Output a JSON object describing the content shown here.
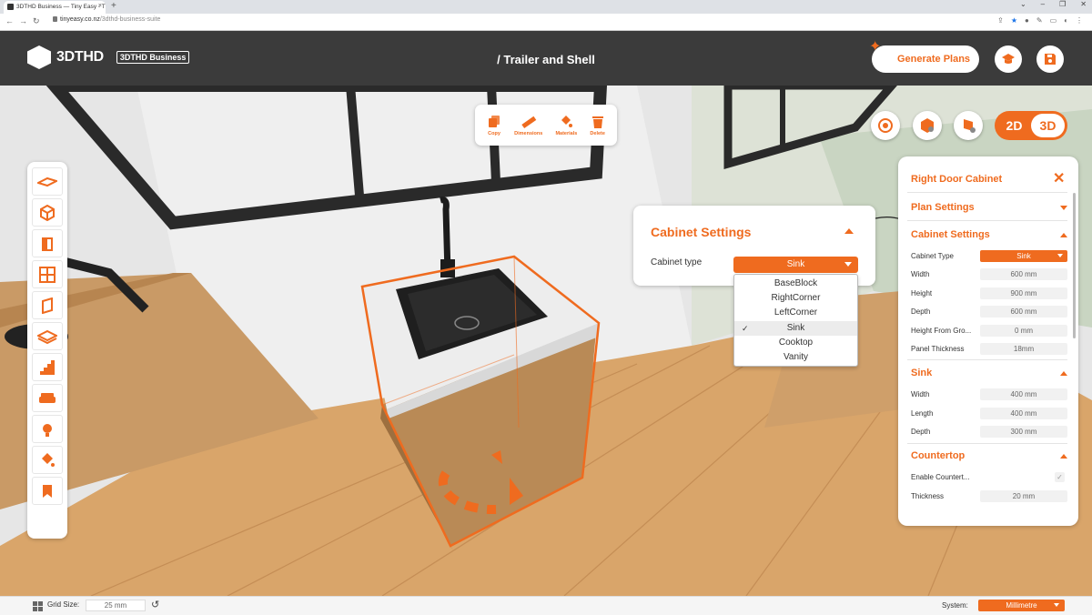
{
  "browser": {
    "tab_title": "3DTHD Business — Tiny Easy - T",
    "url_host": "tinyeasy.co.nz",
    "url_path": "/3dthd-business-suite"
  },
  "header": {
    "logo_text": "3DTHD",
    "business_badge": "3DTHD Business",
    "breadcrumb": "/ Trailer and Shell",
    "generate_label": "Generate Plans",
    "accent": "#ef6b1f",
    "bar_color": "#3b3b3b"
  },
  "floating_toolbar": {
    "items": [
      {
        "label": "Copy",
        "icon": "copy-icon"
      },
      {
        "label": "Dimensions",
        "icon": "ruler-icon"
      },
      {
        "label": "Materials",
        "icon": "paint-bucket-icon"
      },
      {
        "label": "Delete",
        "icon": "trash-icon"
      }
    ]
  },
  "view_toggle": {
    "option_2d": "2D",
    "option_3d": "3D",
    "active": "3D"
  },
  "left_tools": [
    "floor-icon",
    "cube-icon",
    "door-icon",
    "window-icon",
    "panel-icon",
    "layer-icon",
    "stairs-icon",
    "sofa-icon",
    "light-icon",
    "paint-icon",
    "bookmark-icon"
  ],
  "cabinet_popup": {
    "title": "Cabinet Settings",
    "type_label": "Cabinet type",
    "selected": "Sink",
    "options": [
      "BaseBlock",
      "RightCorner",
      "LeftCorner",
      "Sink",
      "Cooktop",
      "Vanity"
    ]
  },
  "right_panel": {
    "title": "Right Door Cabinet",
    "sections": {
      "plan": "Plan Settings",
      "cabinet": "Cabinet Settings",
      "sink": "Sink",
      "countertop": "Countertop"
    },
    "cabinet_fields": {
      "type": {
        "label": "Cabinet Type",
        "value": "Sink"
      },
      "width": {
        "label": "Width",
        "value": "600 mm"
      },
      "height": {
        "label": "Height",
        "value": "900 mm"
      },
      "depth": {
        "label": "Depth",
        "value": "600 mm"
      },
      "height_from_ground": {
        "label": "Height From Gro...",
        "value": "0 mm"
      },
      "panel_thickness": {
        "label": "Panel Thickness",
        "value": "18mm"
      }
    },
    "sink_fields": {
      "width": {
        "label": "Width",
        "value": "400 mm"
      },
      "length": {
        "label": "Length",
        "value": "400 mm"
      },
      "depth": {
        "label": "Depth",
        "value": "300 mm"
      }
    },
    "countertop_fields": {
      "enable": {
        "label": "Enable Countert..."
      },
      "thickness": {
        "label": "Thickness",
        "value": "20 mm"
      }
    }
  },
  "footer": {
    "grid_label": "Grid Size:",
    "grid_value": "25 mm",
    "system_label": "System:",
    "system_value": "Millimetre"
  }
}
